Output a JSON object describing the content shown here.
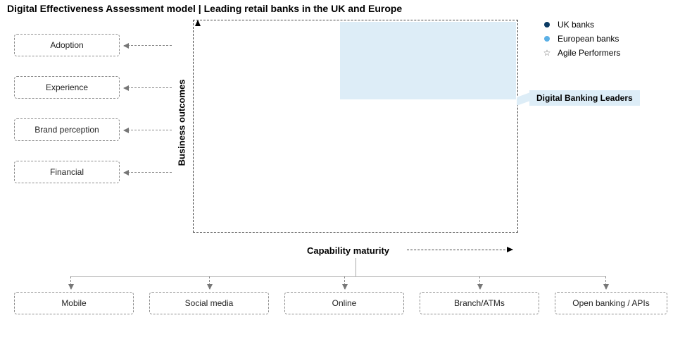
{
  "title": "Digital Effectiveness Assessment model | Leading retail banks in the UK and Europe",
  "axes": {
    "y": "Business outcomes",
    "x": "Capability maturity"
  },
  "zone_label": "Digital Banking Leaders",
  "legend": [
    {
      "symbol": "dot-dark",
      "label": "UK banks"
    },
    {
      "symbol": "dot-light",
      "label": "European banks"
    },
    {
      "symbol": "star",
      "label": "Agile Performers"
    }
  ],
  "outcomes": [
    "Adoption",
    "Experience",
    "Brand perception",
    "Financial"
  ],
  "capabilities": [
    "Mobile",
    "Social media",
    "Online",
    "Branch/ATMs",
    "Open banking / APIs"
  ],
  "chart_data": {
    "type": "diagram",
    "title": "Digital Effectiveness Assessment model | Leading retail banks in the UK and Europe",
    "x_axis": {
      "label": "Capability maturity",
      "direction": "increasing-right",
      "components": [
        "Mobile",
        "Social media",
        "Online",
        "Branch/ATMs",
        "Open banking / APIs"
      ]
    },
    "y_axis": {
      "label": "Business outcomes",
      "direction": "increasing-up",
      "components": [
        "Adoption",
        "Experience",
        "Brand perception",
        "Financial"
      ]
    },
    "series": [
      {
        "name": "UK banks",
        "marker": "dark-blue-dot",
        "points": []
      },
      {
        "name": "European banks",
        "marker": "light-blue-dot",
        "points": []
      },
      {
        "name": "Agile Performers",
        "marker": "star-outline",
        "points": []
      }
    ],
    "highlight_zone": {
      "name": "Digital Banking Leaders",
      "x_range": "high",
      "y_range": "high"
    }
  }
}
